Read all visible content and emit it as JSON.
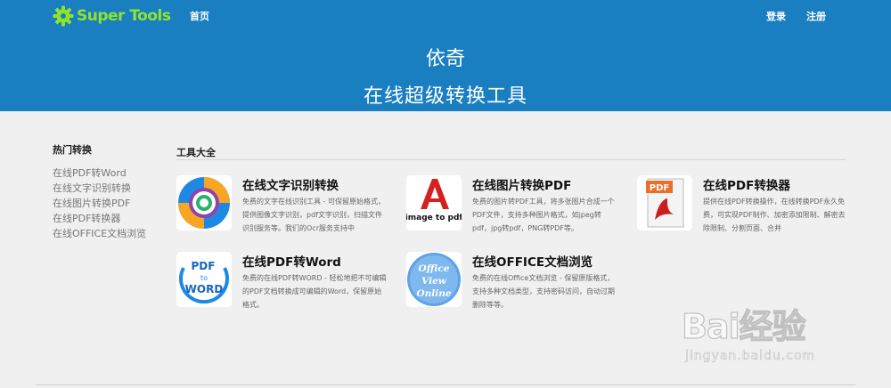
{
  "nav": {
    "logo_text": "Super Tools",
    "home": "首页",
    "login": "登录",
    "register": "注册"
  },
  "hero": {
    "title": "依奇",
    "subtitle": "在线超级转换工具"
  },
  "sidebar": {
    "heading": "热门转换",
    "items": [
      {
        "label": "在线PDF转Word"
      },
      {
        "label": "在线文字识别转换"
      },
      {
        "label": "在线图片转换PDF"
      },
      {
        "label": "在线PDF转换器"
      },
      {
        "label": "在线OFFICE文档浏览"
      }
    ]
  },
  "tools": {
    "heading": "工具大全",
    "items": [
      {
        "title": "在线文字识别转换",
        "desc": "免费的文字在线识别工具 - 可保留原始格式，提供图像文字识别，pdf文字识别，扫描文件识别服务等。我们的Ocr服务支持中",
        "icon": "ocr-icon"
      },
      {
        "title": "在线图片转换PDF",
        "desc": "免费的图片转PDF工具，将多张图片合成一个PDF文件，支持多种图片格式，如jpeg转pdf，jpg转pdf，PNG转PDF等。",
        "icon": "image-to-pdf-icon",
        "icon_text": "image to pdf"
      },
      {
        "title": "在线PDF转换器",
        "desc": "提供在线PDF转换操作，在线转换PDF永久免费，可实现PDF制作、加密添加限制、解密去除限制、分割页面、合并",
        "icon": "pdf-document-icon",
        "icon_text": "PDF"
      },
      {
        "title": "在线PDF转Word",
        "desc": "免费的在线PDF转WORD - 轻松地把不可编辑的PDF文档转换成可编辑的Word，保留原始格式。",
        "icon": "pdf-to-word-icon",
        "icon_text": [
          "PDF",
          "to",
          "WORD"
        ]
      },
      {
        "title": "在线OFFICE文档浏览",
        "desc": "免费的在线Office文档浏览 - 保留原版格式，支持多种文档类型，支持密码访问，自动过期删除等等。",
        "icon": "office-view-online-icon",
        "icon_text": [
          "Office",
          "View",
          "Online"
        ]
      }
    ]
  },
  "watermark": {
    "main": "Bai经验",
    "sub": "jingyan.baidu.com"
  },
  "colors": {
    "header_blue": "#1a7fc1",
    "logo_green": "#8fe42a",
    "page_bg": "#f0f0f0"
  }
}
